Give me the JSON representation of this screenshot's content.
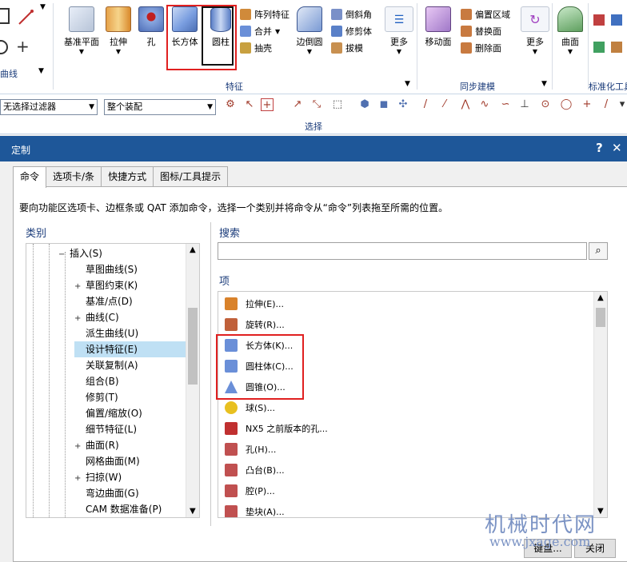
{
  "ribbon": {
    "left_group": {
      "label": "曲线"
    },
    "buttons": [
      {
        "label": "基准平面"
      },
      {
        "label": "拉伸"
      },
      {
        "label": "孔"
      },
      {
        "label": "长方体"
      },
      {
        "label": "圆柱"
      }
    ],
    "small_features": [
      {
        "label": "阵列特征"
      },
      {
        "label": "合并"
      },
      {
        "label": "抽壳"
      }
    ],
    "edge_blend": {
      "label": "边倒圆"
    },
    "small_features2": [
      {
        "label": "倒斜角"
      },
      {
        "label": "修剪体"
      },
      {
        "label": "拔模"
      }
    ],
    "more1": {
      "label": "更多"
    },
    "move_face": {
      "label": "移动面"
    },
    "sync_items": [
      {
        "label": "偏置区域"
      },
      {
        "label": "替换面"
      },
      {
        "label": "删除面"
      }
    ],
    "more2": {
      "label": "更多"
    },
    "surface": {
      "label": "曲面"
    },
    "groups": {
      "feature": "特征",
      "sync": "同步建模",
      "std": "标准化工具"
    }
  },
  "selection_bar": {
    "filter": "无选择过滤器",
    "scope": "整个装配",
    "group_label": "选择"
  },
  "dialog": {
    "title": "定制",
    "help": "?",
    "close": "✕",
    "tabs": [
      {
        "label": "命令"
      },
      {
        "label": "选项卡/条"
      },
      {
        "label": "快捷方式"
      },
      {
        "label": "图标/工具提示"
      }
    ],
    "instruction": "要向功能区选项卡、边框条或 QAT 添加命令，选择一个类别并将命令从“命令”列表拖至所需的位置。",
    "category_label": "类别",
    "search_label": "搜索",
    "search_placeholder": "",
    "items_label": "项",
    "categories": [
      {
        "label": "插入(S)",
        "expander": "−"
      },
      {
        "label": "草图曲线(S)",
        "expander": ""
      },
      {
        "label": "草图约束(K)",
        "expander": "+"
      },
      {
        "label": "基准/点(D)",
        "expander": ""
      },
      {
        "label": "曲线(C)",
        "expander": "+"
      },
      {
        "label": "派生曲线(U)",
        "expander": ""
      },
      {
        "label": "设计特征(E)",
        "expander": ""
      },
      {
        "label": "关联复制(A)",
        "expander": ""
      },
      {
        "label": "组合(B)",
        "expander": ""
      },
      {
        "label": "修剪(T)",
        "expander": ""
      },
      {
        "label": "偏置/缩放(O)",
        "expander": ""
      },
      {
        "label": "细节特征(L)",
        "expander": ""
      },
      {
        "label": "曲面(R)",
        "expander": "+"
      },
      {
        "label": "网格曲面(M)",
        "expander": ""
      },
      {
        "label": "扫掠(W)",
        "expander": "+"
      },
      {
        "label": "弯边曲面(G)",
        "expander": ""
      },
      {
        "label": "CAM 数据准备(P)",
        "expander": ""
      }
    ],
    "selected_category": "设计特征(E)",
    "items": [
      {
        "label": "拉伸(E)...",
        "color": "#d9822b"
      },
      {
        "label": "旋转(R)...",
        "color": "#c0603a"
      },
      {
        "label": "长方体(K)...",
        "color": "#6a8fd8"
      },
      {
        "label": "圆柱体(C)...",
        "color": "#6a8fd8"
      },
      {
        "label": "圆锥(O)...",
        "color": "#6a8fd8"
      },
      {
        "label": "球(S)...",
        "color": "#e8c020"
      },
      {
        "label": "NX5 之前版本的孔...",
        "color": "#c03030"
      },
      {
        "label": "孔(H)...",
        "color": "#c05050"
      },
      {
        "label": "凸台(B)...",
        "color": "#c05050"
      },
      {
        "label": "腔(P)...",
        "color": "#c05050"
      },
      {
        "label": "垫块(A)...",
        "color": "#c05050"
      }
    ],
    "keyboard_button": "键盘...",
    "close_button": "关闭"
  },
  "watermark": {
    "line1": "机械时代网",
    "line2": "www.jxage.com"
  }
}
